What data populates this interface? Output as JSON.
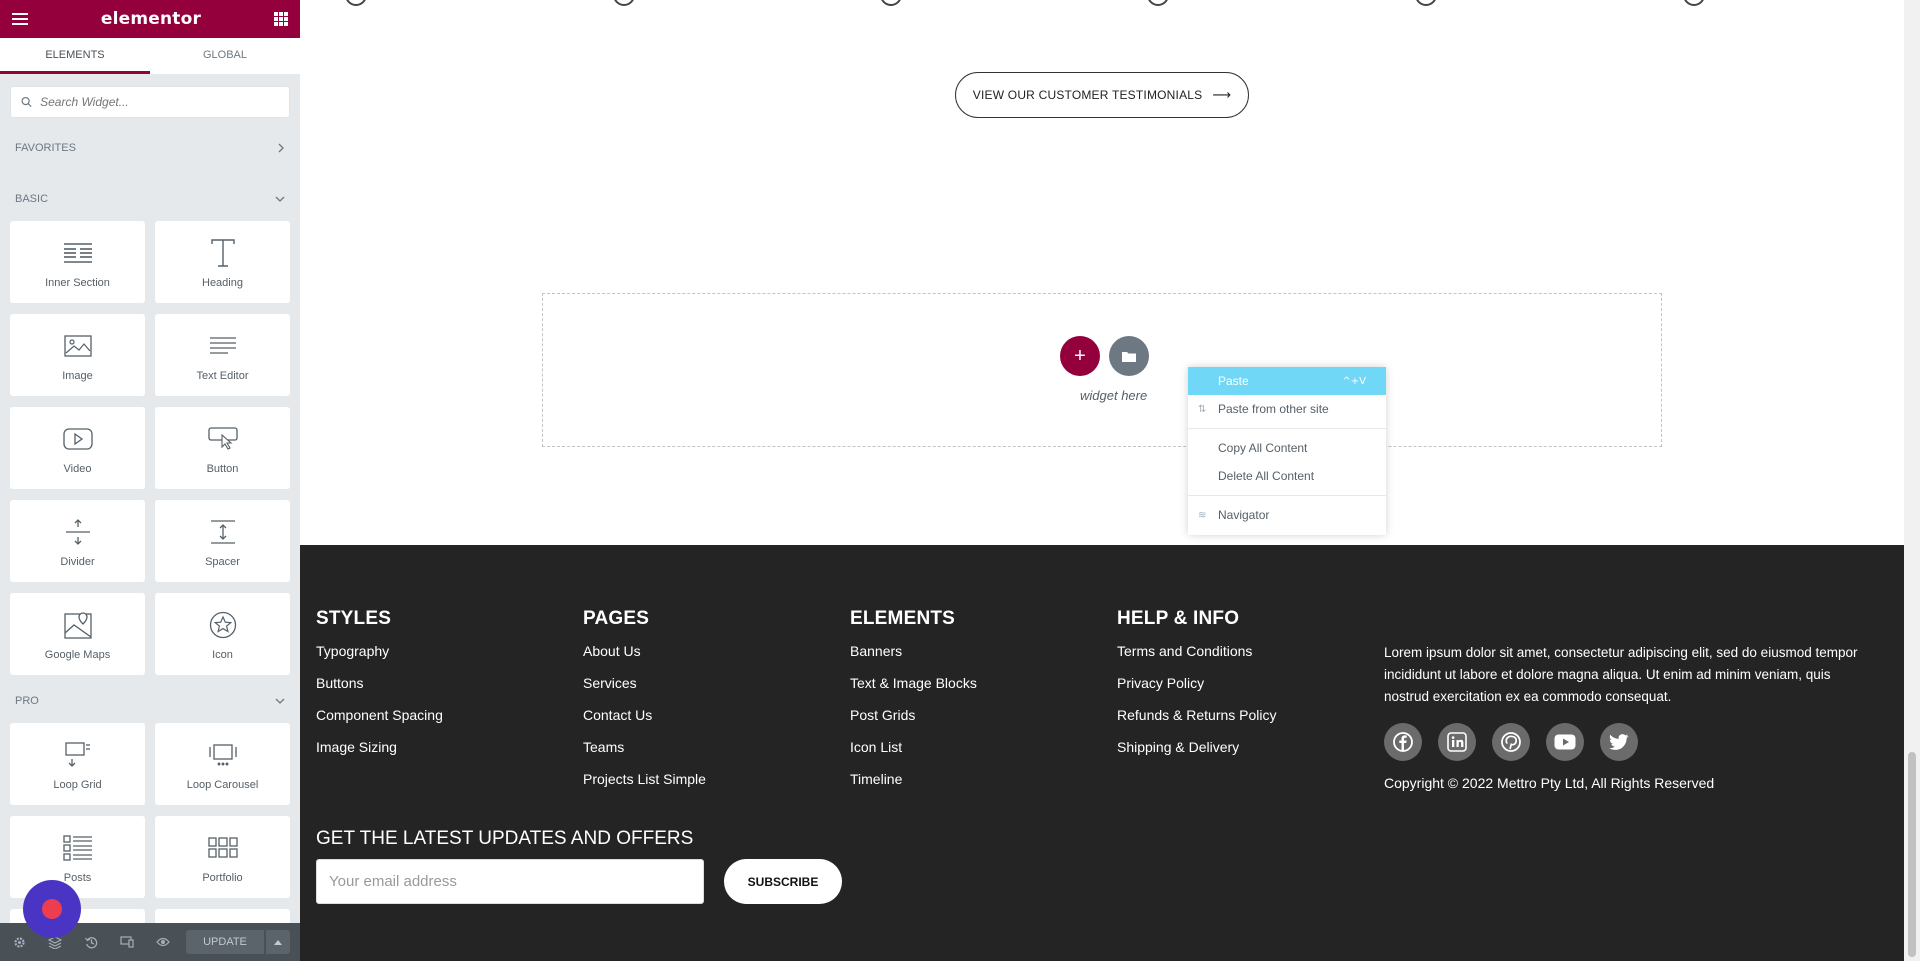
{
  "app": {
    "brand": "elementor"
  },
  "tabs": [
    {
      "label": "ELEMENTS"
    },
    {
      "label": "GLOBAL"
    }
  ],
  "search": {
    "placeholder": "Search Widget..."
  },
  "categories": {
    "favorites": {
      "label": "FAVORITES"
    },
    "basic": {
      "label": "BASIC"
    },
    "pro": {
      "label": "PRO"
    }
  },
  "widgets_basic": [
    {
      "label": "Inner Section",
      "icon": "inner-section-icon"
    },
    {
      "label": "Heading",
      "icon": "heading-icon"
    },
    {
      "label": "Image",
      "icon": "image-icon"
    },
    {
      "label": "Text Editor",
      "icon": "text-editor-icon"
    },
    {
      "label": "Video",
      "icon": "video-icon"
    },
    {
      "label": "Button",
      "icon": "button-icon"
    },
    {
      "label": "Divider",
      "icon": "divider-icon"
    },
    {
      "label": "Spacer",
      "icon": "spacer-icon"
    },
    {
      "label": "Google Maps",
      "icon": "google-maps-icon"
    },
    {
      "label": "Icon",
      "icon": "star-icon"
    }
  ],
  "widgets_pro": [
    {
      "label": "Loop Grid",
      "icon": "loop-grid-icon"
    },
    {
      "label": "Loop Carousel",
      "icon": "loop-carousel-icon"
    },
    {
      "label": "Posts",
      "icon": "posts-icon"
    },
    {
      "label": "Portfolio",
      "icon": "portfolio-icon"
    }
  ],
  "bottombar": {
    "update_label": "UPDATE"
  },
  "canvas": {
    "testimonials_button": "VIEW OUR CUSTOMER TESTIMONIALS",
    "drop_hint": "widget here"
  },
  "context_menu": {
    "items": [
      {
        "label": "Paste",
        "shortcut": "^+V"
      },
      {
        "label": "Paste from other site"
      },
      {
        "label": "Copy All Content"
      },
      {
        "label": "Delete All Content"
      },
      {
        "label": "Navigator"
      }
    ]
  },
  "footer": {
    "columns": [
      {
        "title": "STYLES",
        "links": [
          "Typography",
          "Buttons",
          "Component Spacing",
          "Image Sizing"
        ]
      },
      {
        "title": "PAGES",
        "links": [
          "About Us",
          "Services",
          "Contact Us",
          "Teams",
          "Projects List Simple"
        ]
      },
      {
        "title": "ELEMENTS",
        "links": [
          "Banners",
          "Text & Image Blocks",
          "Post Grids",
          "Icon List",
          "Timeline"
        ]
      },
      {
        "title": "HELP & INFO",
        "links": [
          "Terms and Conditions",
          "Privacy Policy",
          "Refunds & Returns Policy",
          "Shipping & Delivery"
        ]
      }
    ],
    "about": "Lorem ipsum dolor sit amet, consectetur adipiscing elit, sed do eiusmod tempor incididunt ut labore et dolore magna aliqua. Ut enim ad minim veniam, quis nostrud exercitation ex ea commodo consequat.",
    "socials": [
      "facebook-icon",
      "linkedin-icon",
      "pinterest-icon",
      "youtube-icon",
      "twitter-icon"
    ],
    "copyright": "Copyright © 2022 Mettro Pty Ltd, All Rights Reserved",
    "newsletter_title": "GET THE LATEST UPDATES AND OFFERS",
    "email_placeholder": "Your email address",
    "subscribe_label": "SUBSCRIBE"
  },
  "colors": {
    "brand": "#93003c",
    "sidebar_bg": "#e6e9ec",
    "footer_bg": "#242424",
    "menu_highlight": "#71d7f7",
    "chat_bubble": "#4a34c4"
  }
}
